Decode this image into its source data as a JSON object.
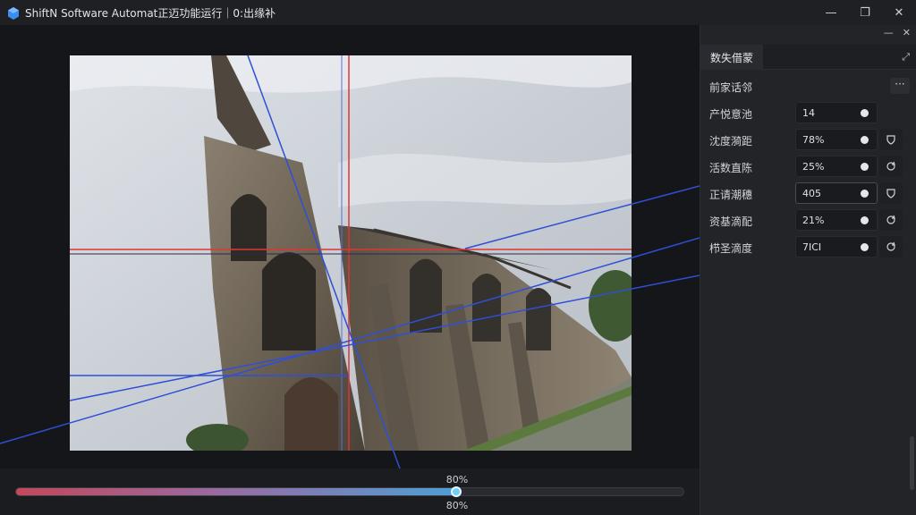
{
  "window": {
    "title": "ShiftN Software Automat正迈功能运行｜0:出缘补",
    "minimize_label": "—",
    "maximize_label": "❐",
    "close_label": "✕"
  },
  "panel": {
    "top_minimize_label": "—",
    "top_close_label": "✕",
    "tab_label": "数失借蒙",
    "expand_label": "⤢",
    "section_label": "前家话邻",
    "more_label": "···",
    "rows": [
      {
        "label": "产悦意池",
        "value": "14",
        "action": ""
      },
      {
        "label": "沈度漪距",
        "value": "78%",
        "action": "pin"
      },
      {
        "label": "活数直陈",
        "value": "25%",
        "action": "rotate"
      },
      {
        "label": "正请潮穗",
        "value": "405",
        "action": "pin"
      },
      {
        "label": "资基滴配",
        "value": "21%",
        "action": "rotate"
      },
      {
        "label": "栉圣滴度",
        "value": "7ICI",
        "action": "rotate"
      }
    ]
  },
  "slider": {
    "value_top": "80%",
    "value_bottom": "80%",
    "fraction": 0.66
  },
  "colors": {
    "guide_red": "#e03434",
    "guide_blue": "#2f4fd6",
    "accent": "#6fd0f2"
  }
}
